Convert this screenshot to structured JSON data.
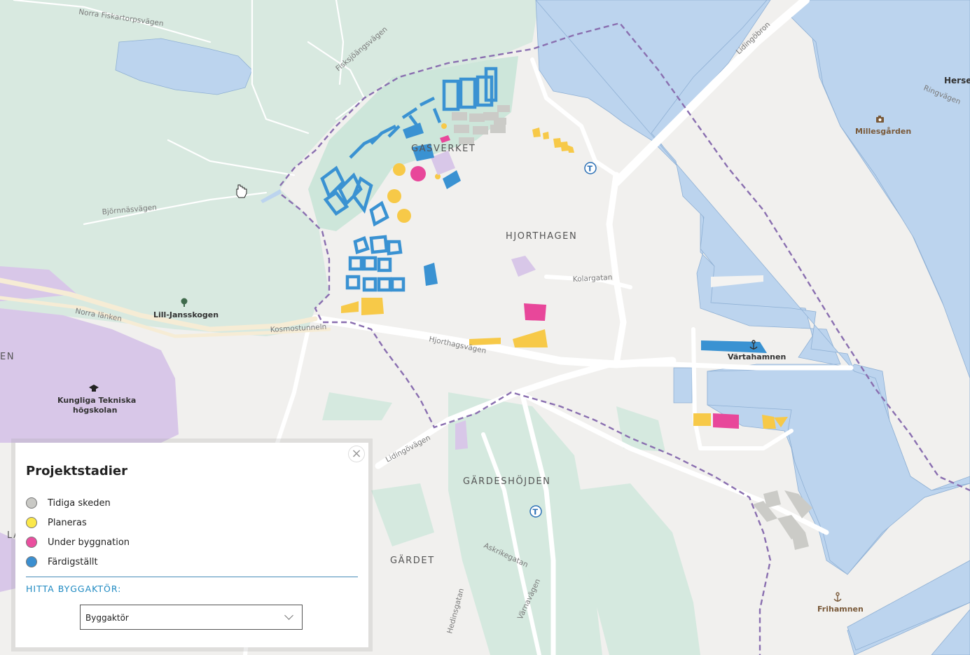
{
  "map": {
    "areas": {
      "gasverket": "GASVERKET",
      "hjorthagen": "HJORTHAGEN",
      "gardeshojden": "GÄRDESHÖJDEN",
      "gardet": "GÄRDET",
      "edge_en": "EN",
      "edge_la": "LA"
    },
    "roads": {
      "norra_fiskartorpsvagen": "Norra Fiskartorpsvägen",
      "fisksjoangsvagen": "Fisksjöängsvägen",
      "bjornnasvagen": "Björnnäsvägen",
      "norra_lanken": "Norra länken",
      "kosmostunneln": "Kosmostunneln",
      "hjorthagsvagen": "Hjorthagsvägen",
      "kolargatan": "Kolargatan",
      "lidingobron": "Lidingöbron",
      "ringvagen": "Ringvägen",
      "lidingovagen": "Lidingövägen",
      "askrikegatan": "Askrikegatan",
      "hedinsgatan": "Hedinsgatan",
      "varnavagen": "Värnavägen"
    },
    "pois": {
      "lill_jansskogen": "Lill-Jansskogen",
      "kth_line1": "Kungliga Tekniska",
      "kth_line2": "högskolan",
      "millesgarden": "Millesgården",
      "vartahamnen": "Värtahamnen",
      "frihamnen": "Frihamnen",
      "herse": "Herse"
    },
    "metro_symbol": "T",
    "colors": {
      "water": "#bcd4ee",
      "park": "#cfe7dc",
      "forest": "#d8e9e0",
      "campus": "#d8c7e8",
      "land": "#f1f0ee",
      "boundary": "#8a6fb0",
      "early": "#cbcbc7",
      "planned": "#f7c948",
      "under_construction": "#e8479a",
      "completed": "#3a92d2"
    }
  },
  "panel": {
    "title": "Projektstadier",
    "close_symbol": "×",
    "legend": [
      {
        "label": "Tidiga skeden",
        "color": "#c9c9c5"
      },
      {
        "label": "Planeras",
        "color": "#fbe84a"
      },
      {
        "label": "Under byggnation",
        "color": "#ea4f9f"
      },
      {
        "label": "Färdigställt",
        "color": "#3b8fd0"
      }
    ],
    "find_label": "HITTA BYGGAKTÖR:",
    "select_value": "Byggaktör"
  }
}
